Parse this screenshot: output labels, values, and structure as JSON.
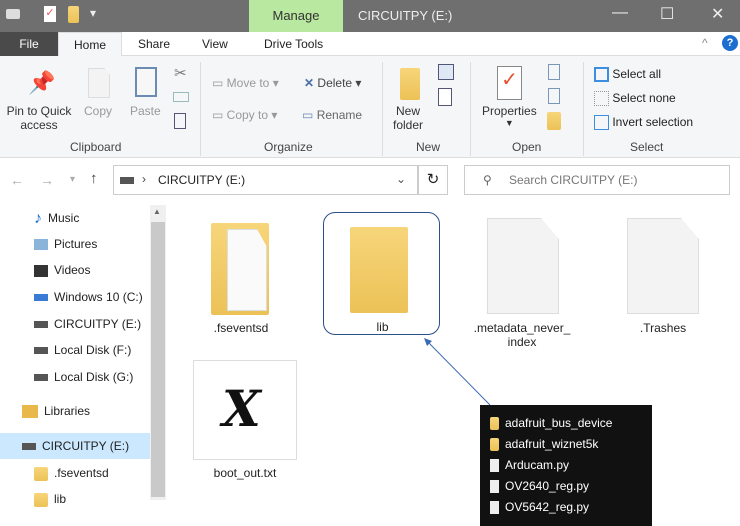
{
  "window": {
    "title": "CIRCUITPY (E:)",
    "context_tab": "Manage",
    "minimize": "—",
    "maximize": "☐",
    "close": "✕"
  },
  "tabs": [
    "File",
    "Home",
    "Share",
    "View",
    "Drive Tools"
  ],
  "ribbon": {
    "clipboard": {
      "pin": "Pin to Quick",
      "pin2": "access",
      "copy": "Copy",
      "paste": "Paste",
      "group": "Clipboard"
    },
    "organize": {
      "move": "Move to",
      "copy": "Copy to",
      "delete": "Delete",
      "rename": "Rename",
      "group": "Organize"
    },
    "new": {
      "folder": "New",
      "folder2": "folder",
      "group": "New"
    },
    "open": {
      "properties": "Properties",
      "group": "Open"
    },
    "select": {
      "all": "Select all",
      "none": "Select none",
      "invert": "Invert selection",
      "group": "Select"
    }
  },
  "address": {
    "path": "CIRCUITPY (E:)",
    "search_placeholder": "Search CIRCUITPY (E:)"
  },
  "nav": [
    "Music",
    "Pictures",
    "Videos",
    "Windows 10 (C:)",
    "CIRCUITPY (E:)",
    "Local Disk (F:)",
    "Local Disk (G:)",
    "Libraries",
    "CIRCUITPY (E:)",
    ".fseventsd",
    "lib"
  ],
  "files": [
    ".fseventsd",
    "lib",
    ".metadata_never_",
    "index",
    ".Trashes",
    "boot_out.txt"
  ],
  "popup": [
    "adafruit_bus_device",
    "adafruit_wiznet5k",
    "Arducam.py",
    "OV2640_reg.py",
    "OV5642_reg.py"
  ]
}
